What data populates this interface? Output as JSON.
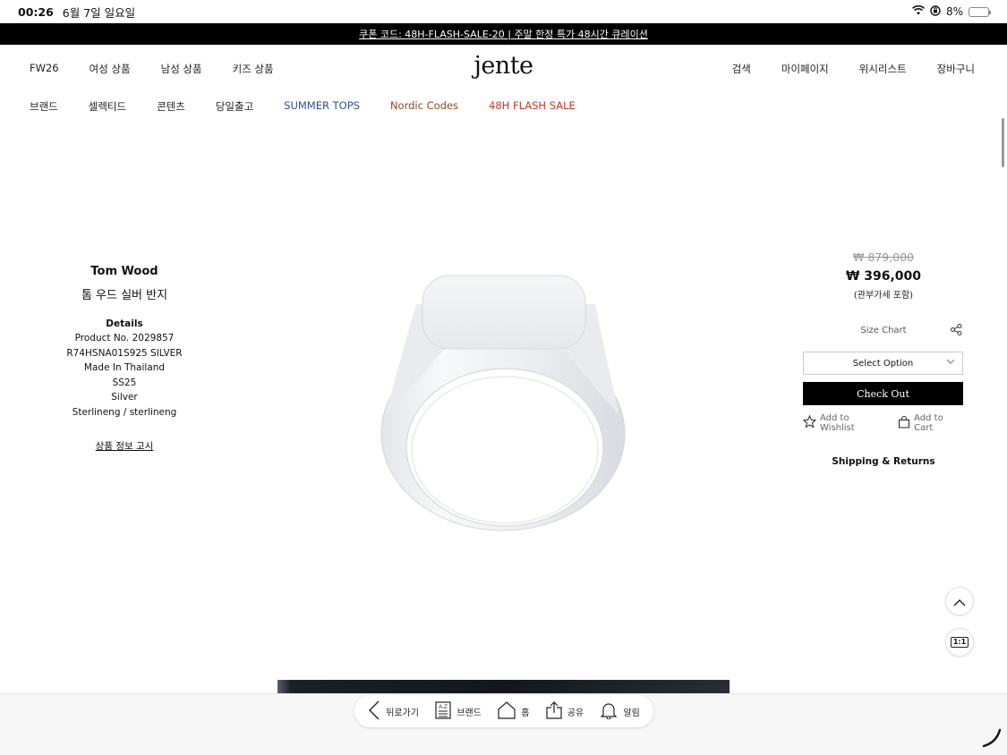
{
  "status_bar": {
    "time": "00:26",
    "date": "6월 7일 일요일",
    "battery": "8%",
    "battery_level": 0.08
  },
  "promo_banner": "쿠폰 코드: 48H-FLASH-SALE-20 | 주말 한정 특가 48시간 큐레이션",
  "nav": {
    "logo": "jente",
    "primary": [
      "FW26",
      "여성 상품",
      "남성 상품",
      "키즈 상품"
    ],
    "utility": [
      "검색",
      "마이페이지",
      "위시리스트",
      "장바구니"
    ],
    "secondary": [
      {
        "label": "브랜드",
        "color": "#222222"
      },
      {
        "label": "셀렉티드",
        "color": "#222222"
      },
      {
        "label": "콘텐츠",
        "color": "#222222"
      },
      {
        "label": "당일출고",
        "color": "#222222"
      },
      {
        "label": "SUMMER TOPS",
        "color": "#2f4f8a"
      },
      {
        "label": "Nordic Codes",
        "color": "#8a4a1e"
      },
      {
        "label": "48H FLASH SALE",
        "color": "#c0392b"
      }
    ]
  },
  "product": {
    "brand": "Tom Wood",
    "name": "톰 우드 실버 반지",
    "details_title": "Details",
    "details": [
      "Product No.  2029857",
      "R74HSNA01S925 SILVER",
      "Made In Thailand",
      "SS25",
      "Silver",
      "Sterlineng / sterlineng"
    ],
    "notice_link": "상품 정보 고시"
  },
  "purchase": {
    "original_price": "₩ 879,000",
    "sale_price": "₩ 396,000",
    "price_note": "(관부가세 포함)",
    "size_chart": "Size Chart",
    "select_option": "Select Option",
    "checkout": "Check Out",
    "add_to_wishlist": "Add to Wishlist",
    "add_to_cart": "Add to Cart",
    "shipping_returns": "Shipping & Returns"
  },
  "fab": {
    "zoom_label": "1:1"
  },
  "toolbar": {
    "back": "뒤로가기",
    "brand": "브랜드",
    "az_label": "A-Z",
    "home": "홈",
    "share": "공유",
    "alerts": "알림"
  }
}
